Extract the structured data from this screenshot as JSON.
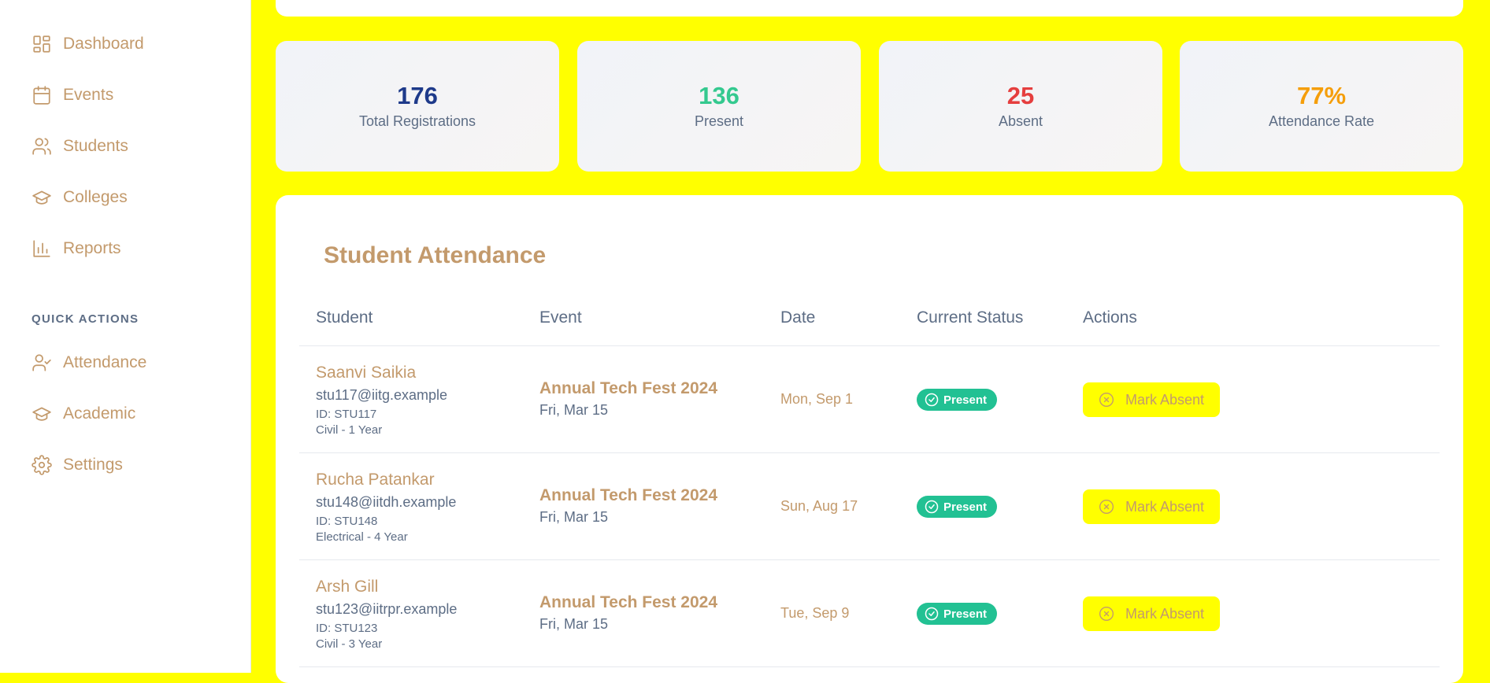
{
  "sidebar": {
    "nav": [
      {
        "label": "Dashboard",
        "icon": "grid-icon"
      },
      {
        "label": "Events",
        "icon": "calendar-icon"
      },
      {
        "label": "Students",
        "icon": "users-icon"
      },
      {
        "label": "Colleges",
        "icon": "graduation-cap-icon"
      },
      {
        "label": "Reports",
        "icon": "bar-chart-icon"
      }
    ],
    "quick_actions_label": "QUICK ACTIONS",
    "quick": [
      {
        "label": "Attendance",
        "icon": "user-check-icon"
      },
      {
        "label": "Academic",
        "icon": "graduation-cap-icon"
      },
      {
        "label": "Settings",
        "icon": "gear-icon"
      }
    ]
  },
  "stats": [
    {
      "value": "176",
      "label": "Total Registrations",
      "color": "#1e3a8a"
    },
    {
      "value": "136",
      "label": "Present",
      "color": "#34c98f"
    },
    {
      "value": "25",
      "label": "Absent",
      "color": "#e53e3e"
    },
    {
      "value": "77%",
      "label": "Attendance Rate",
      "color": "#f59e0b"
    }
  ],
  "attendance": {
    "title": "Student Attendance",
    "columns": [
      "Student",
      "Event",
      "Date",
      "Current Status",
      "Actions"
    ],
    "rows": [
      {
        "name": "Saanvi Saikia",
        "email": "stu117@iitg.example",
        "id": "ID: STU117",
        "dept": "Civil - 1 Year",
        "event": "Annual Tech Fest 2024",
        "event_date": "Fri, Mar 15",
        "date": "Mon, Sep 1",
        "status": "Present",
        "action": "Mark Absent"
      },
      {
        "name": "Rucha Patankar",
        "email": "stu148@iitdh.example",
        "id": "ID: STU148",
        "dept": "Electrical - 4 Year",
        "event": "Annual Tech Fest 2024",
        "event_date": "Fri, Mar 15",
        "date": "Sun, Aug 17",
        "status": "Present",
        "action": "Mark Absent"
      },
      {
        "name": "Arsh Gill",
        "email": "stu123@iitrpr.example",
        "id": "ID: STU123",
        "dept": "Civil - 3 Year",
        "event": "Annual Tech Fest 2024",
        "event_date": "Fri, Mar 15",
        "date": "Tue, Sep 9",
        "status": "Present",
        "action": "Mark Absent"
      }
    ]
  }
}
